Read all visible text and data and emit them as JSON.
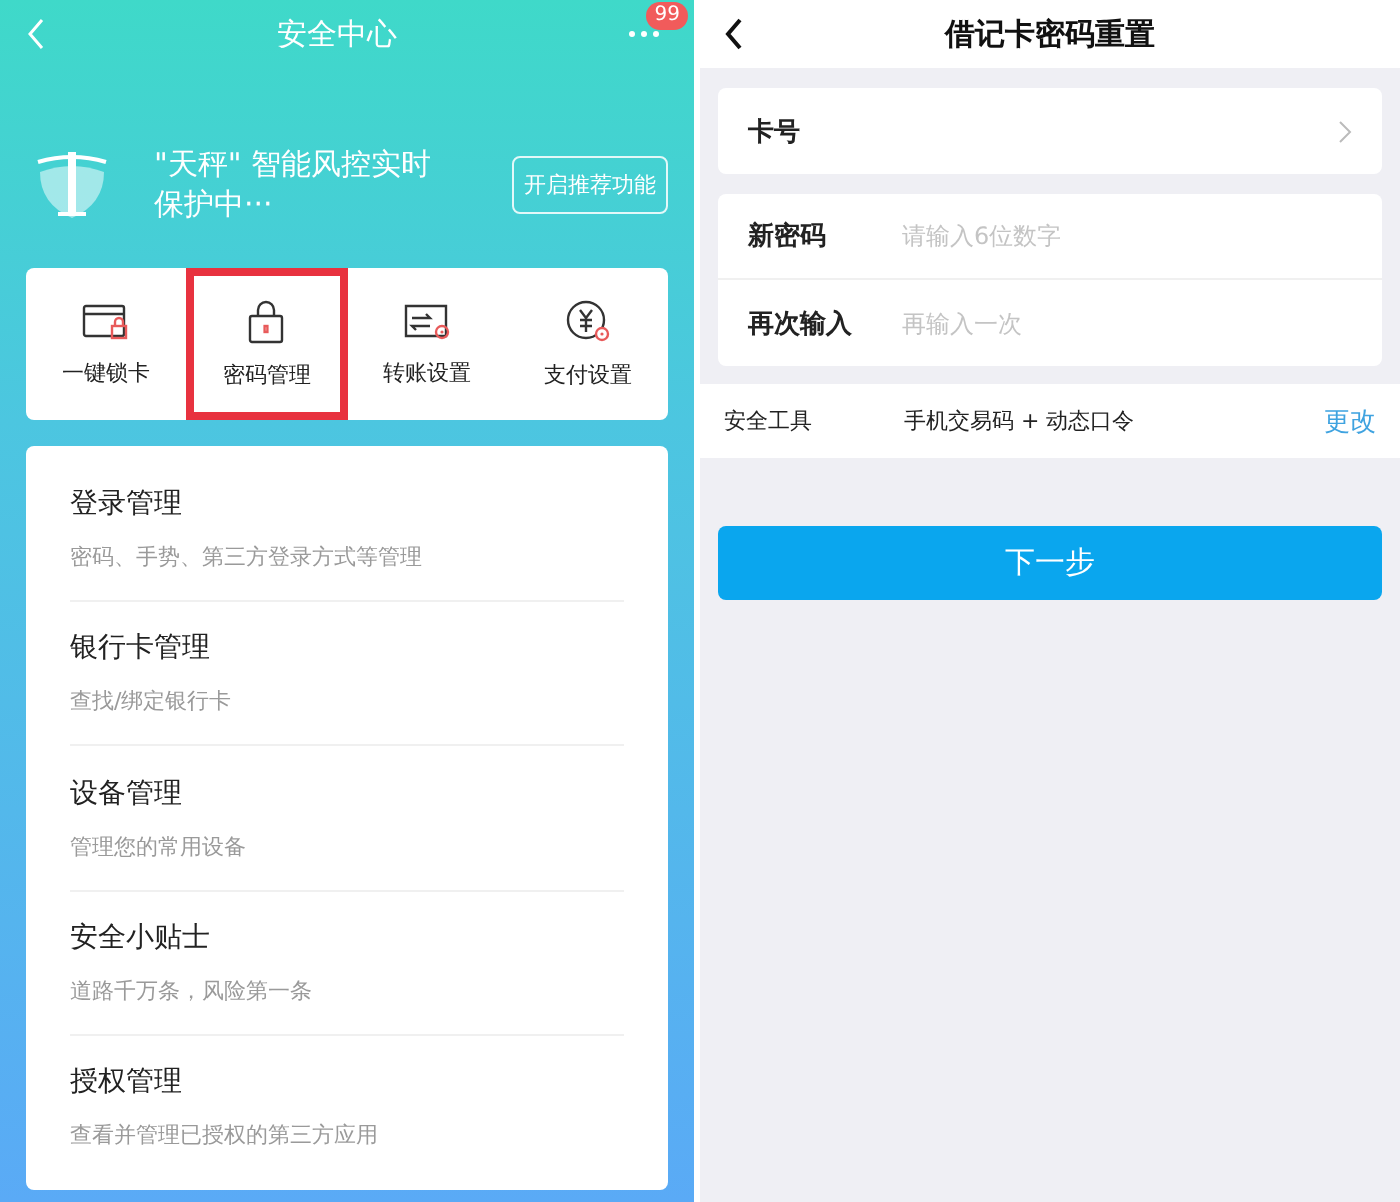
{
  "left": {
    "header": {
      "title": "安全中心",
      "badge": "99"
    },
    "banner": {
      "text": "\"天秤\" 智能风控实时保护中···",
      "button": "开启推荐功能"
    },
    "quick_actions": [
      {
        "label": "一键锁卡",
        "kind": "card-lock",
        "highlighted": false
      },
      {
        "label": "密码管理",
        "kind": "padlock",
        "highlighted": true
      },
      {
        "label": "转账设置",
        "kind": "transfer",
        "highlighted": false
      },
      {
        "label": "支付设置",
        "kind": "yuan",
        "highlighted": false
      }
    ],
    "menu": [
      {
        "title": "登录管理",
        "subtitle": "密码、手势、第三方登录方式等管理"
      },
      {
        "title": "银行卡管理",
        "subtitle": "查找/绑定银行卡"
      },
      {
        "title": "设备管理",
        "subtitle": "管理您的常用设备"
      },
      {
        "title": "安全小贴士",
        "subtitle": "道路千万条，风险第一条"
      },
      {
        "title": "授权管理",
        "subtitle": "查看并管理已授权的第三方应用"
      }
    ]
  },
  "right": {
    "header": {
      "title": "借记卡密码重置"
    },
    "card_row": {
      "label": "卡号"
    },
    "fields": [
      {
        "label": "新密码",
        "placeholder": "请输入6位数字"
      },
      {
        "label": "再次输入",
        "placeholder": "再输入一次"
      }
    ],
    "security_tool": {
      "label": "安全工具",
      "value": "手机交易码 + 动态口令",
      "action": "更改"
    },
    "next_button": "下一步"
  }
}
